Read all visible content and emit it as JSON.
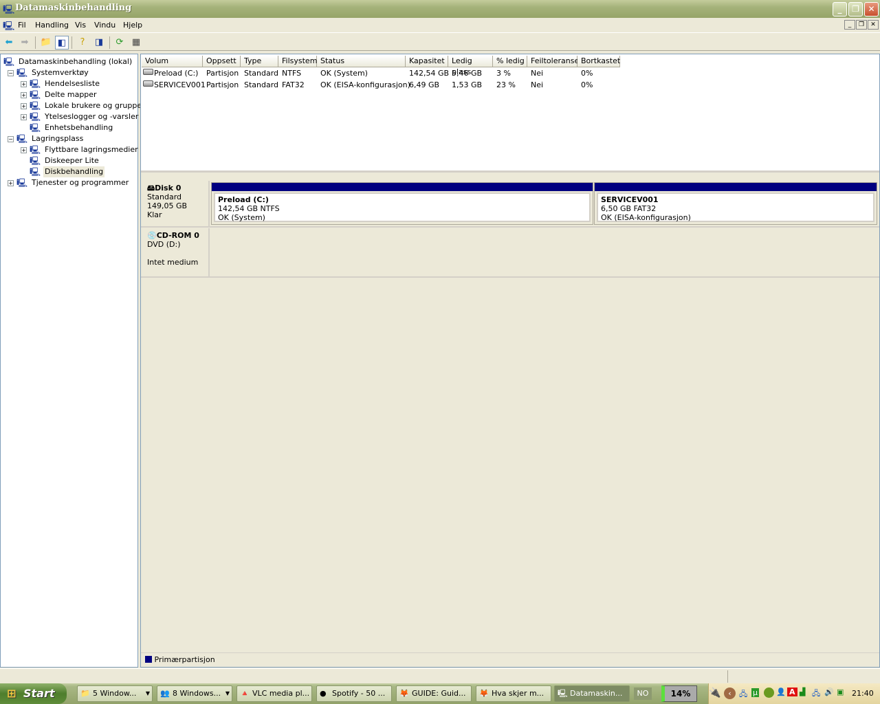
{
  "window": {
    "title": "Datamaskinbehandling"
  },
  "menu": [
    "Fil",
    "Handling",
    "Vis",
    "Vindu",
    "Hjelp"
  ],
  "tree": [
    {
      "label": "Datamaskinbehandling (lokal)",
      "level": 0,
      "exp": ""
    },
    {
      "label": "Systemverktøy",
      "level": 1,
      "exp": "−"
    },
    {
      "label": "Hendelsesliste",
      "level": 2,
      "exp": "+"
    },
    {
      "label": "Delte mapper",
      "level": 2,
      "exp": "+"
    },
    {
      "label": "Lokale brukere og grupper",
      "level": 2,
      "exp": "+"
    },
    {
      "label": "Ytelseslogger og -varsler",
      "level": 2,
      "exp": "+"
    },
    {
      "label": "Enhetsbehandling",
      "level": 2,
      "exp": ""
    },
    {
      "label": "Lagringsplass",
      "level": 1,
      "exp": "−"
    },
    {
      "label": "Flyttbare lagringsmedier",
      "level": 2,
      "exp": "+"
    },
    {
      "label": "Diskeeper Lite",
      "level": 2,
      "exp": ""
    },
    {
      "label": "Diskbehandling",
      "level": 2,
      "exp": "",
      "selected": true
    },
    {
      "label": "Tjenester og programmer",
      "level": 1,
      "exp": "+"
    }
  ],
  "volumes": {
    "columns": [
      "Volum",
      "Oppsett",
      "Type",
      "Filsystem",
      "Status",
      "Kapasitet",
      "Ledig plass",
      "% ledig",
      "Feiltoleranse",
      "Bortkastet"
    ],
    "rows": [
      [
        "Preload (C:)",
        "Partisjon",
        "Standard",
        "NTFS",
        "OK (System)",
        "142,54 GB",
        "5,46 GB",
        "3 %",
        "Nei",
        "0%"
      ],
      [
        "SERVICEV001",
        "Partisjon",
        "Standard",
        "FAT32",
        "OK (EISA-konfigurasjon)",
        "6,49 GB",
        "1,53 GB",
        "23 %",
        "Nei",
        "0%"
      ]
    ]
  },
  "disks": {
    "disk0": {
      "name": "Disk 0",
      "type": "Standard",
      "size": "149,05 GB",
      "state": "Klar",
      "partitions": [
        {
          "name": "Preload  (C:)",
          "info": "142,54 GB NTFS",
          "status": "OK (System)"
        },
        {
          "name": "SERVICEV001",
          "info": "6,50 GB FAT32",
          "status": "OK (EISA-konfigurasjon)"
        }
      ]
    },
    "cdrom0": {
      "name": "CD-ROM 0",
      "drive": "DVD (D:)",
      "state": "Intet medium"
    }
  },
  "legend": {
    "label": "Primærpartisjon",
    "color": "#000080"
  },
  "taskbar": {
    "start": "Start",
    "buttons": [
      "5 Window...",
      "8 Windows...",
      "VLC media pl...",
      "Spotify - 50 ...",
      "GUIDE: Guid...",
      "Hva skjer m...",
      "Datamaskin..."
    ],
    "lang": "NO",
    "battery": "14%",
    "clock": "21:40"
  }
}
